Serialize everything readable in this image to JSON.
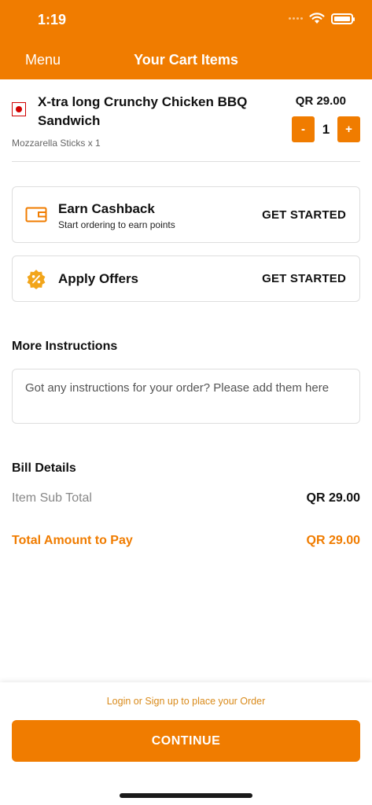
{
  "status_bar": {
    "time": "1:19"
  },
  "header": {
    "menu_label": "Menu",
    "title": "Your Cart Items"
  },
  "cart_item": {
    "name": "X-tra long Crunchy Chicken BBQ Sandwich",
    "addon": "Mozzarella Sticks x 1",
    "price": "QR 29.00",
    "quantity": "1",
    "minus_label": "-",
    "plus_label": "+"
  },
  "cashback": {
    "title": "Earn Cashback",
    "subtitle": "Start ordering to earn points",
    "action": "GET STARTED",
    "icon": "wallet-icon"
  },
  "offers": {
    "title": "Apply Offers",
    "action": "GET STARTED",
    "icon": "discount-badge-icon"
  },
  "instructions": {
    "title": "More Instructions",
    "placeholder": "Got any instructions for your order? Please add them here"
  },
  "bill": {
    "title": "Bill Details",
    "subtotal_label": "Item Sub Total",
    "subtotal_value": "QR 29.00",
    "total_label": "Total Amount to Pay",
    "total_value": "QR 29.00"
  },
  "footer": {
    "login_note": "Login or Sign up to place your Order",
    "continue_label": "CONTINUE"
  },
  "colors": {
    "accent": "#F07C00",
    "veg_mark": "#D00000",
    "note": "#D98A1A"
  }
}
